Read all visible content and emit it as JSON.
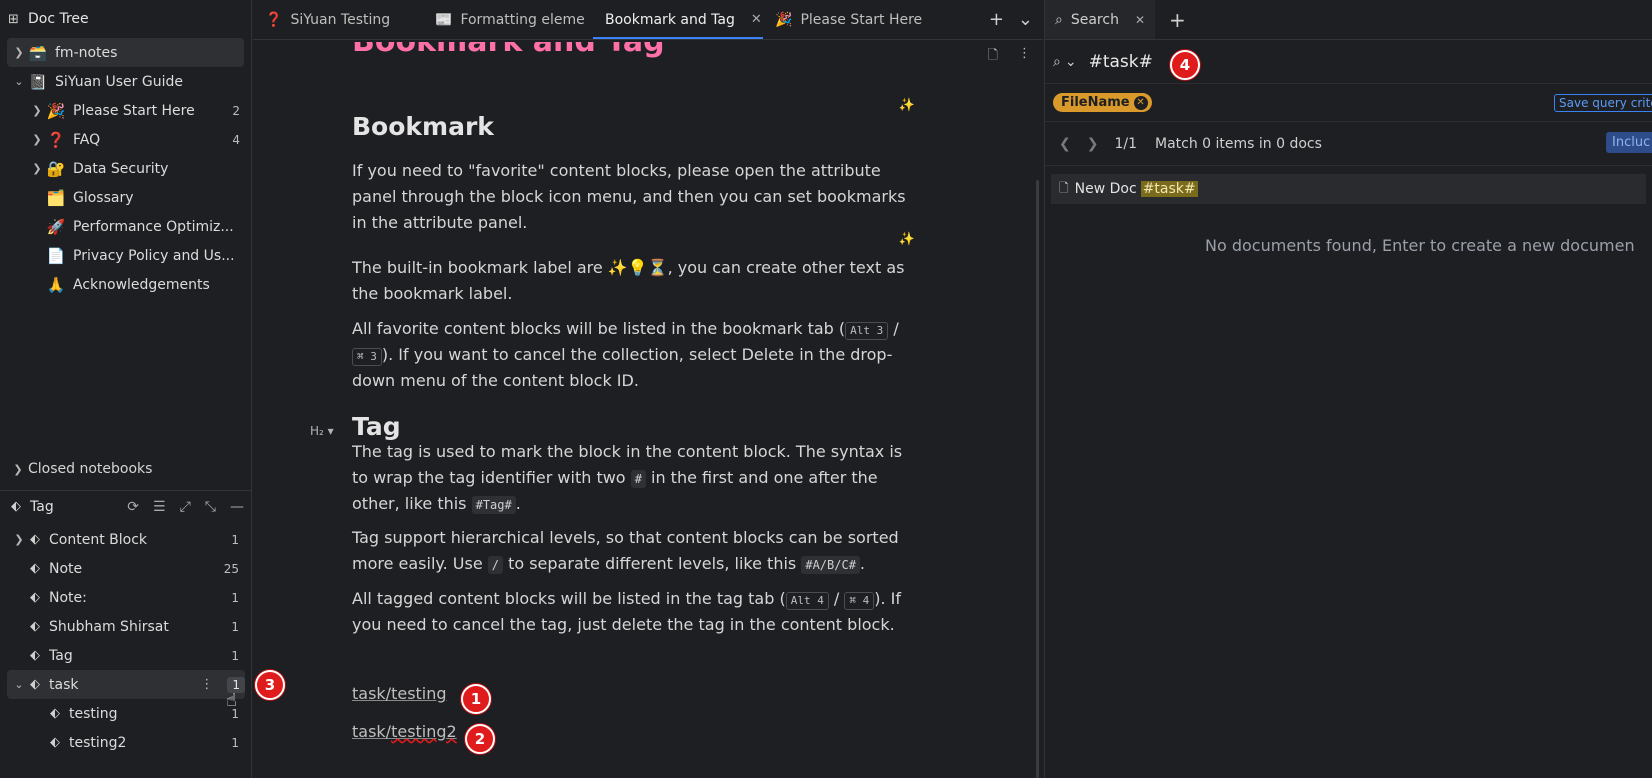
{
  "left_panel": {
    "title": "Doc Tree",
    "notebooks": [
      {
        "label": "fm-notes",
        "emoji": "🗃️",
        "expanded": false,
        "selected": true
      },
      {
        "label": "SiYuan User Guide",
        "emoji": "📓",
        "expanded": true
      }
    ],
    "guide_docs": [
      {
        "label": "Please Start Here",
        "emoji": "🎉",
        "count": "2",
        "has_children": true
      },
      {
        "label": "FAQ",
        "emoji": "❓",
        "count": "4",
        "has_children": true
      },
      {
        "label": "Data Security",
        "emoji": "🔐",
        "count": "",
        "has_children": true
      },
      {
        "label": "Glossary",
        "emoji": "🗂️",
        "count": "",
        "has_children": false
      },
      {
        "label": "Performance Optimiz...",
        "emoji": "🚀",
        "count": "",
        "has_children": false
      },
      {
        "label": "Privacy Policy and Us...",
        "emoji": "📄",
        "count": "",
        "has_children": false
      },
      {
        "label": "Acknowledgements",
        "emoji": "🙏",
        "count": "",
        "has_children": false
      }
    ],
    "closed_notebooks": "Closed notebooks"
  },
  "tag_panel": {
    "title": "Tag",
    "tags": [
      {
        "label": "Content Block",
        "count": "1",
        "has_children": true
      },
      {
        "label": "Note",
        "count": "25",
        "has_children": false
      },
      {
        "label": "Note:",
        "count": "1",
        "has_children": false
      },
      {
        "label": "Shubham Shirsat",
        "count": "1",
        "has_children": false
      },
      {
        "label": "Tag",
        "count": "1",
        "has_children": false
      }
    ],
    "task": {
      "label": "task",
      "count": "1"
    },
    "task_children": [
      {
        "label": "testing",
        "count": "1"
      },
      {
        "label": "testing2",
        "count": "1"
      }
    ]
  },
  "editor": {
    "tabs": [
      {
        "label": "SiYuan Testing",
        "emoji": "❓"
      },
      {
        "label": "Formatting eleme",
        "emoji": "📰"
      },
      {
        "label": "Bookmark and Tag",
        "emoji": "",
        "active": true
      },
      {
        "label": "Please Start Here",
        "emoji": "🎉"
      }
    ],
    "title": "Bookmark and Tag",
    "h2_bookmark": "Bookmark",
    "p1": "If you need to \"favorite\" content blocks, please open the attribute panel through the block icon menu, and then you can set bookmarks in the attribute panel.",
    "p2_a": "The built-in bookmark label are ✨💡⏳, you can create other text as the bookmark label.",
    "p3_a": "All favorite content blocks will be listed in the bookmark tab (",
    "p3_k1": "Alt 3",
    "p3_sep": " / ",
    "p3_k2": "⌘ 3",
    "p3_b": "). If you want to cancel the collection, select Delete in the drop-down menu of the content block ID.",
    "h2_marker": "H₂ ▾",
    "h2_tag": "Tag",
    "p4_a": "The tag is used to mark the block in the content block. The syntax is to wrap the tag identifier with two ",
    "p4_c1": "#",
    "p4_b": " in the first and one after the other, like this ",
    "p4_c2": "#Tag#",
    "p4_c": ".",
    "p5_a": "Tag support hierarchical levels, so that content blocks can be sorted more easily. Use ",
    "p5_c1": "/",
    "p5_b": " to separate different levels, like this ",
    "p5_c2": "#A/B/C#",
    "p5_c": ".",
    "p6_a": "All tagged content blocks will be listed in the tag tab (",
    "p6_k1": "Alt 4",
    "p6_sep": " / ",
    "p6_k2": "⌘ 4",
    "p6_b": "). If you need to cancel the tag, just delete the tag in the content block.",
    "tag_link_1": "task/testing",
    "tag_link_2_a": "task/",
    "tag_link_2_b": "testing2"
  },
  "search_panel": {
    "tab_label": "Search",
    "query": "#task#",
    "filter_chip": "FileName",
    "save_query": "Save query crite",
    "page": "1/1",
    "match_text": "Match 0 items in 0 docs",
    "include_btn": "Incluc",
    "new_doc_label": "New Doc",
    "new_doc_tag": "#task#",
    "no_docs": "No documents found, Enter to create a new documen"
  },
  "annotations": [
    "1",
    "2",
    "3",
    "4"
  ],
  "colors": {
    "accent": "#3b82f6",
    "badge": "#e01b1b",
    "title": "#ff6fa8",
    "chip": "#d99a2b"
  }
}
